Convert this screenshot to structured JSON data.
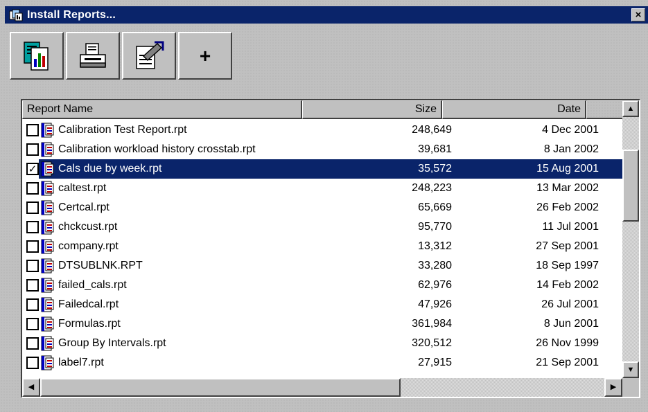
{
  "window": {
    "title": "Install Reports...",
    "close_glyph": "×"
  },
  "toolbar": {
    "buttons": [
      {
        "name": "preview-report-button",
        "icon": "report-preview-icon"
      },
      {
        "name": "print-report-button",
        "icon": "printer-icon"
      },
      {
        "name": "edit-report-button",
        "icon": "edit-document-icon"
      },
      {
        "name": "add-report-button",
        "icon": "plus-icon",
        "label": "+"
      }
    ]
  },
  "list": {
    "columns": {
      "name": "Report Name",
      "size": "Size",
      "date": "Date"
    },
    "rows": [
      {
        "name": "Calibration Test Report.rpt",
        "size": "248,649",
        "date": "4 Dec 2001",
        "checked": false,
        "selected": false
      },
      {
        "name": "Calibration workload history crosstab.rpt",
        "size": "39,681",
        "date": "8 Jan 2002",
        "checked": false,
        "selected": false
      },
      {
        "name": "Cals due by week.rpt",
        "size": "35,572",
        "date": "15 Aug 2001",
        "checked": true,
        "selected": true
      },
      {
        "name": "caltest.rpt",
        "size": "248,223",
        "date": "13 Mar 2002",
        "checked": false,
        "selected": false
      },
      {
        "name": "Certcal.rpt",
        "size": "65,669",
        "date": "26 Feb 2002",
        "checked": false,
        "selected": false
      },
      {
        "name": "chckcust.rpt",
        "size": "95,770",
        "date": "11 Jul 2001",
        "checked": false,
        "selected": false
      },
      {
        "name": "company.rpt",
        "size": "13,312",
        "date": "27 Sep 2001",
        "checked": false,
        "selected": false
      },
      {
        "name": "DTSUBLNK.RPT",
        "size": "33,280",
        "date": "18 Sep 1997",
        "checked": false,
        "selected": false
      },
      {
        "name": "failed_cals.rpt",
        "size": "62,976",
        "date": "14 Feb 2002",
        "checked": false,
        "selected": false
      },
      {
        "name": "Failedcal.rpt",
        "size": "47,926",
        "date": "26 Jul 2001",
        "checked": false,
        "selected": false
      },
      {
        "name": "Formulas.rpt",
        "size": "361,984",
        "date": "8 Jun 2001",
        "checked": false,
        "selected": false
      },
      {
        "name": "Group By Intervals.rpt",
        "size": "320,512",
        "date": "26 Nov 1999",
        "checked": false,
        "selected": false
      },
      {
        "name": "label7.rpt",
        "size": "27,915",
        "date": "21 Sep 2001",
        "checked": false,
        "selected": false
      }
    ],
    "check_glyph": "✓"
  },
  "scrollbars": {
    "up_glyph": "▲",
    "down_glyph": "▼",
    "left_glyph": "◀",
    "right_glyph": "▶"
  },
  "colors": {
    "titlebar": "#0a246a",
    "selection": "#0a246a",
    "face": "#c0c0c0"
  }
}
